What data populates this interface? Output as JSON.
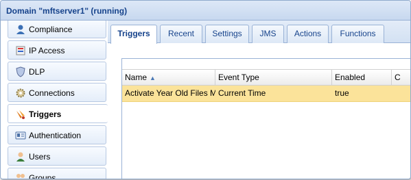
{
  "window": {
    "title": "Domain \"mftserver1\" (running)"
  },
  "sidebar": {
    "items": [
      {
        "label": "Compliance",
        "icon": "compliance-icon"
      },
      {
        "label": "IP Access",
        "icon": "ip-access-icon"
      },
      {
        "label": "DLP",
        "icon": "dlp-shield-icon"
      },
      {
        "label": "Connections",
        "icon": "connections-gear-icon"
      },
      {
        "label": "Triggers",
        "icon": "triggers-icon",
        "active": true
      },
      {
        "label": "Authentication",
        "icon": "authentication-icon"
      },
      {
        "label": "Users",
        "icon": "users-icon"
      },
      {
        "label": "Groups",
        "icon": "groups-icon"
      }
    ]
  },
  "tabs": [
    {
      "label": "Triggers",
      "active": true
    },
    {
      "label": "Recent"
    },
    {
      "label": "Settings"
    },
    {
      "label": "JMS"
    },
    {
      "label": "Actions"
    },
    {
      "label": "Functions"
    }
  ],
  "grid": {
    "columns": [
      "Name",
      "Event Type",
      "Enabled",
      "C"
    ],
    "sort_column": "Name",
    "rows": [
      {
        "name": "Activate Year Old Files M",
        "event_type": "Current Time",
        "enabled": "true",
        "extra": ""
      }
    ]
  },
  "colors": {
    "title_text": "#15428b",
    "selected_row": "#fbe39a",
    "border": "#99b2d6"
  }
}
